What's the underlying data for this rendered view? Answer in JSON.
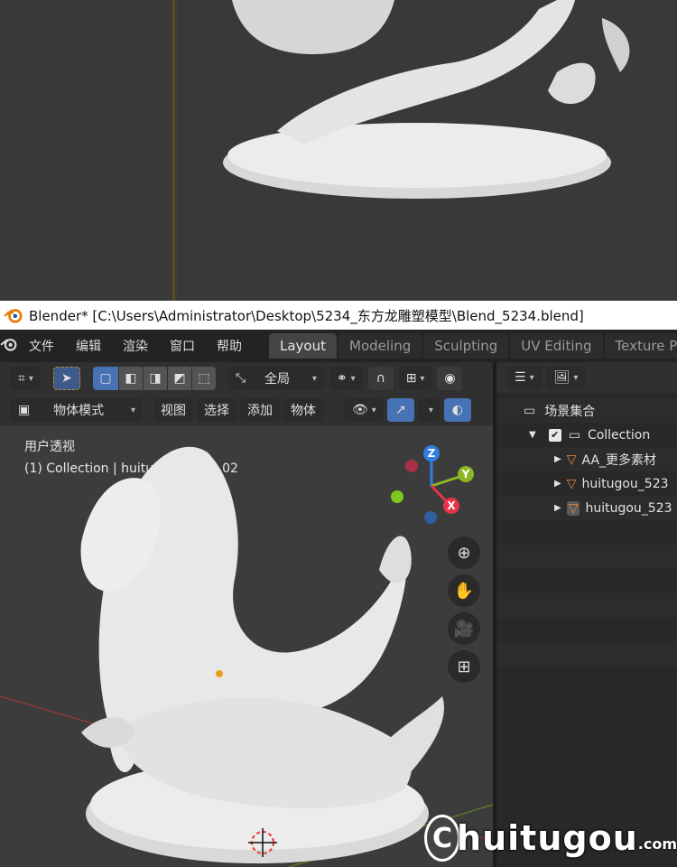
{
  "titlebar": {
    "title": "Blender* [C:\\Users\\Administrator\\Desktop\\5234_东方龙雕塑模型\\Blend_5234.blend]"
  },
  "menu": {
    "items": [
      "文件",
      "编辑",
      "渲染",
      "窗口",
      "帮助"
    ]
  },
  "workspace_tabs": [
    {
      "label": "Layout",
      "active": true
    },
    {
      "label": "Modeling",
      "active": false
    },
    {
      "label": "Sculpting",
      "active": false
    },
    {
      "label": "UV Editing",
      "active": false
    },
    {
      "label": "Texture Pain",
      "active": false
    }
  ],
  "viewport_header": {
    "orientation_label": "全局",
    "mode_label": "物体模式",
    "menus": [
      "视图",
      "选择",
      "添加",
      "物体"
    ]
  },
  "viewport": {
    "view_name": "用户透视",
    "collection_info": "(1) Collection | huitugou_5234_02"
  },
  "gizmo": {
    "axis_z": "Z",
    "axis_y": "Y",
    "axis_x": "X",
    "color_x": "#e8314a",
    "color_y": "#8cb623",
    "color_z": "#2e7fe0"
  },
  "outliner": {
    "scene_collection": "场景集合",
    "collection": "Collection",
    "objects": [
      "AA_更多素材",
      "huitugou_523",
      "huitugou_523"
    ]
  },
  "watermark": {
    "badge": "C",
    "text": "huitugou",
    "suffix": ".com"
  },
  "colors": {
    "accent_blue": "#4772b3",
    "object_orange": "#e8873a"
  }
}
